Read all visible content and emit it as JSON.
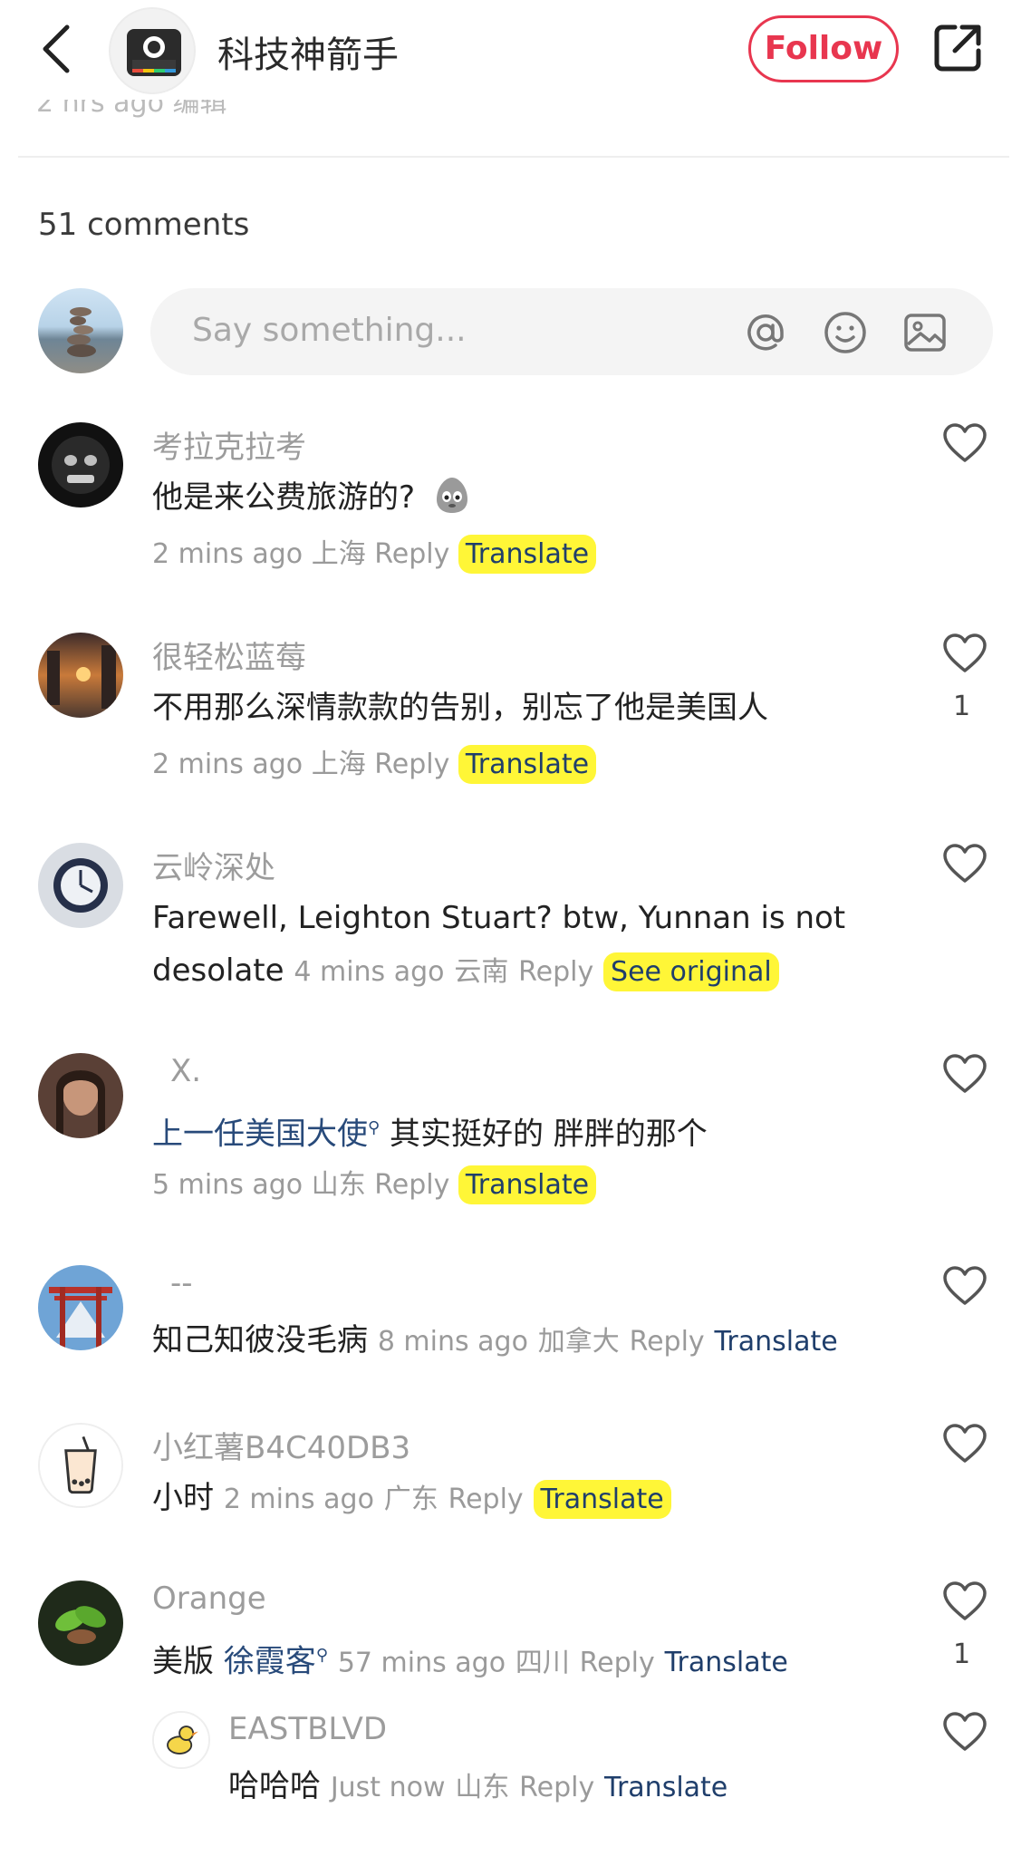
{
  "header": {
    "author_name": "科技神箭手",
    "follow_label": "Follow",
    "partial_text": "2 hrs ago 编辑"
  },
  "comments_count": "51 comments",
  "input": {
    "placeholder": "Say something..."
  },
  "colors": {
    "accent": "#e8364f",
    "translate_link": "#1f3e6b",
    "highlight": "#fff514"
  },
  "comments": [
    {
      "username": "考拉克拉考",
      "text": "他是来公费旅游的?",
      "emoji": "worried-face-sticker",
      "time": "2 mins ago",
      "location": "上海",
      "reply": "Reply",
      "action": "Translate",
      "likes": ""
    },
    {
      "username": "很轻松蓝莓",
      "text": "不用那么深情款款的告别，别忘了他是美国人",
      "time": "2 mins ago",
      "location": "上海",
      "reply": "Reply",
      "action": "Translate",
      "likes": "1"
    },
    {
      "username": "云岭深处",
      "text_line1": "Farewell, Leighton Stuart? btw, Yunnan is not",
      "text_line2": "desolate",
      "time": "4 mins ago",
      "location": "云南",
      "reply": "Reply",
      "action": "See original",
      "likes": ""
    },
    {
      "username": "X.",
      "link_text": "上一任美国大使",
      "text": " 其实挺好的 胖胖的那个",
      "time": "5 mins ago",
      "location": "山东",
      "reply": "Reply",
      "action": "Translate",
      "likes": ""
    },
    {
      "username": "--",
      "text": "知己知彼没毛病",
      "time": "8 mins ago",
      "location": "加拿大",
      "reply": "Reply",
      "action": "Translate",
      "likes": ""
    },
    {
      "username": "小红薯B4C40DB3",
      "text": "小时",
      "time": "2 mins ago",
      "location": "广东",
      "reply": "Reply",
      "action": "Translate",
      "likes": ""
    },
    {
      "username": "Orange",
      "text": "美版 ",
      "link_text": "徐霞客",
      "time": "57 mins ago",
      "location": "四川",
      "reply": "Reply",
      "action": "Translate",
      "likes": "1"
    }
  ],
  "reply": {
    "username": "EASTBLVD",
    "text": "哈哈哈",
    "time": "Just now",
    "location": "山东",
    "reply": "Reply",
    "action": "Translate"
  }
}
